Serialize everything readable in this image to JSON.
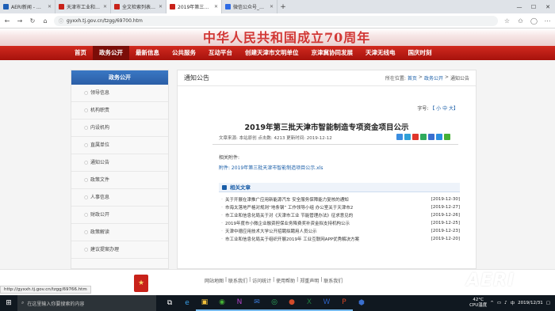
{
  "browser": {
    "tabs": [
      {
        "label": "AERI新闻 - 中国汽车技术研",
        "color": "#1d5fb6",
        "active": false
      },
      {
        "label": "天津市工业和信息化局 — 首",
        "color": "#c8221a",
        "active": false
      },
      {
        "label": "全文检索列表 - 天津市工业",
        "color": "#c8221a",
        "active": false
      },
      {
        "label": "2019年第三批天津市智",
        "color": "#c8221a",
        "active": true
      },
      {
        "label": "微信公众号_百度搜索",
        "color": "#2e6be5",
        "active": false
      }
    ],
    "url": "gyxxh.tj.gov.cn/tzgg/69700.htm",
    "status_url": "http://gyxxh.tj.gov.cn/tzgg/69766.htm"
  },
  "site": {
    "banner_title": "中华人民共和国成立70周年",
    "nav": [
      "首页",
      "政务公开",
      "最新信息",
      "公共服务",
      "互动平台",
      "创建天津市文明单位",
      "京津冀协同发展",
      "天津无线电",
      "国庆时刻"
    ],
    "nav_current": 1
  },
  "sidebar": {
    "title": "政务公开",
    "items": [
      "领导信息",
      "机构职责",
      "内设机构",
      "直属单位",
      "通知公告",
      "政策文件",
      "人事信息",
      "财政公开",
      "政策解读",
      "建议提案办理"
    ]
  },
  "content": {
    "section_title": "通知公告",
    "breadcrumb": {
      "prefix": "所在位置:",
      "items": [
        "首页",
        "政务公开",
        "通知公告"
      ]
    },
    "font_size": {
      "label": "字号:",
      "options": "【 小 中 大】"
    },
    "article_title": "2019年第三批天津市智能制造专项资金项目公示",
    "meta": "文章来源: 本站原创 点击数: 4213 更新时间: 2019-12-12",
    "attachments_label": "相关附件:",
    "attachment": "附件: 2019年第三批天津市智能制造项目公示.xls",
    "related_title": "相关文章",
    "related": [
      {
        "title": "关于开展在津推广应用新能源汽车 安全服务保障能力复核的通知",
        "date": "[2019-12-30]"
      },
      {
        "title": "市海太落地严格对规则“地条钢” 工作领导小组 办公室关于天津市2",
        "date": "[2019-12-27]"
      },
      {
        "title": "市工业和信息化局关于对《天津市工业 节能管理办法》征求意见的",
        "date": "[2019-12-26]"
      },
      {
        "title": "2019年度市小微企业融资担保业务降费奖补资金拟支持机构公示",
        "date": "[2019-12-25]"
      },
      {
        "title": "天津中德应用技术大学公开招聘拟聘用人员公示",
        "date": "[2019-12-23]"
      },
      {
        "title": "市工业和信息化局关于组织开展2019年 工业互联网APP优秀解决方案",
        "date": "[2019-12-20]"
      }
    ],
    "share_colors": [
      "#3b8de0",
      "#2fa0d8",
      "#e0362b",
      "#2eaa5c",
      "#3a6fcf",
      "#2a8fe0",
      "#45b035"
    ]
  },
  "footer": {
    "links": [
      "网站地图",
      "|",
      "联系我们",
      "|",
      "访问统计",
      "|",
      "使用帮助",
      "|",
      "郑重声明",
      "|",
      "联系我们"
    ]
  },
  "watermark": "AERI",
  "taskbar": {
    "search_placeholder": "在这里输入你要搜索的内容",
    "apps": [
      "⧉",
      "e",
      "▣",
      "◉",
      "N",
      "✉",
      "◎",
      "●",
      "X",
      "W",
      "P",
      "⬢"
    ],
    "temperature": "42°C",
    "cpu_label": "CPU温度",
    "time": "",
    "date": "2019/12/31"
  }
}
